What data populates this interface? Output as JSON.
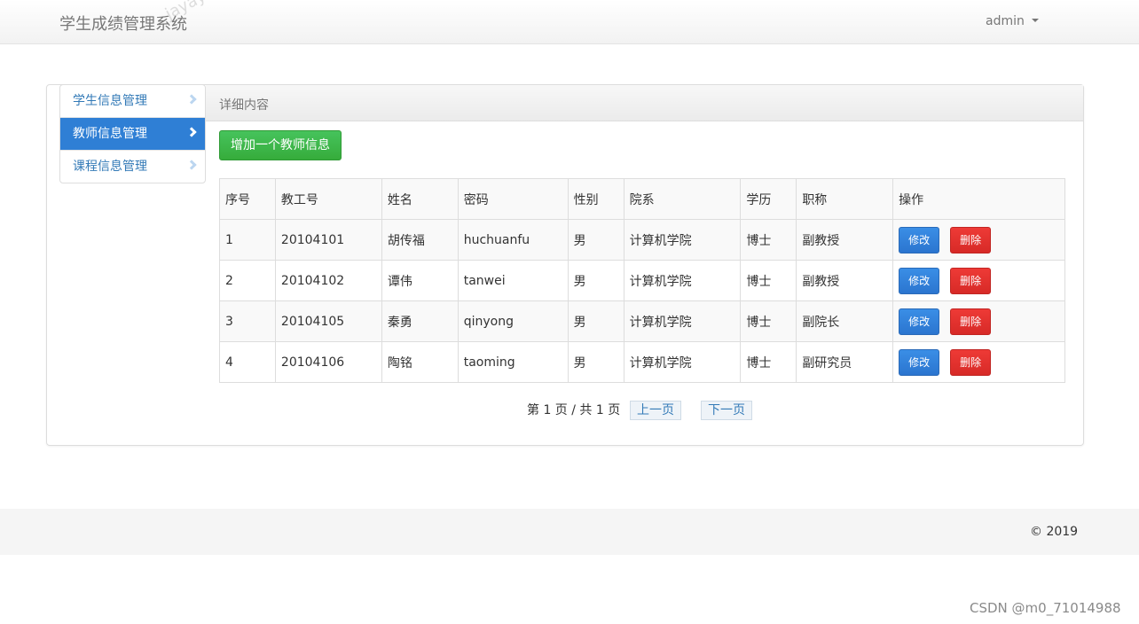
{
  "app": {
    "brand": "学生成绩管理系统",
    "user": "admin",
    "watermark": "jayayms.github.io"
  },
  "sidebar": {
    "items": [
      {
        "label": "学生信息管理",
        "active": false
      },
      {
        "label": "教师信息管理",
        "active": true
      },
      {
        "label": "课程信息管理",
        "active": false
      }
    ]
  },
  "panel": {
    "title": "详细内容",
    "add_button": "增加一个教师信息"
  },
  "table": {
    "headers": [
      "序号",
      "教工号",
      "姓名",
      "密码",
      "性别",
      "院系",
      "学历",
      "职称",
      "操作"
    ],
    "rows": [
      [
        "1",
        "20104101",
        "胡传福",
        "huchuanfu",
        "男",
        "计算机学院",
        "博士",
        "副教授"
      ],
      [
        "2",
        "20104102",
        "谭伟",
        "tanwei",
        "男",
        "计算机学院",
        "博士",
        "副教授"
      ],
      [
        "3",
        "20104105",
        "秦勇",
        "qinyong",
        "男",
        "计算机学院",
        "博士",
        "副院长"
      ],
      [
        "4",
        "20104106",
        "陶铭",
        "taoming",
        "男",
        "计算机学院",
        "博士",
        "副研究员"
      ]
    ],
    "edit_label": "修改",
    "delete_label": "删除"
  },
  "pagination": {
    "info": "第 1 页 / 共 1 页",
    "prev": "上一页",
    "next": "下一页"
  },
  "footer": {
    "copyright": "© 2019"
  },
  "source_mark": "CSDN @m0_71014988",
  "colors": {
    "accent": "#2f7fd5",
    "success": "#36ac3b",
    "danger": "#d72a27"
  }
}
